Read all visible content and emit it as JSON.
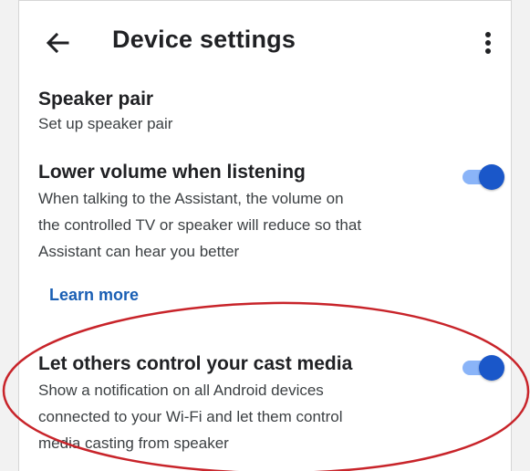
{
  "header": {
    "title": "Device settings",
    "back_icon": "arrow-left-icon",
    "menu_icon": "more-vert-icon"
  },
  "settings": [
    {
      "title": "Speaker pair",
      "description": [
        "Set up speaker pair"
      ]
    },
    {
      "title": "Lower volume when listening",
      "description": [
        "When talking to the Assistant, the volume on",
        "the controlled TV or speaker will reduce so that",
        "Assistant can hear you better"
      ],
      "toggle": "on",
      "link": "Learn more"
    },
    {
      "title": "Let others control your cast media",
      "description": [
        "Show a notification on all Android devices",
        "connected to your Wi-Fi and let them control",
        "media casting from speaker"
      ],
      "toggle": "on"
    }
  ],
  "colors": {
    "toggle_track": "#8ab4f8",
    "toggle_thumb": "#1a57c9",
    "link": "#1a5fb4",
    "annotation": "#c8242a"
  }
}
